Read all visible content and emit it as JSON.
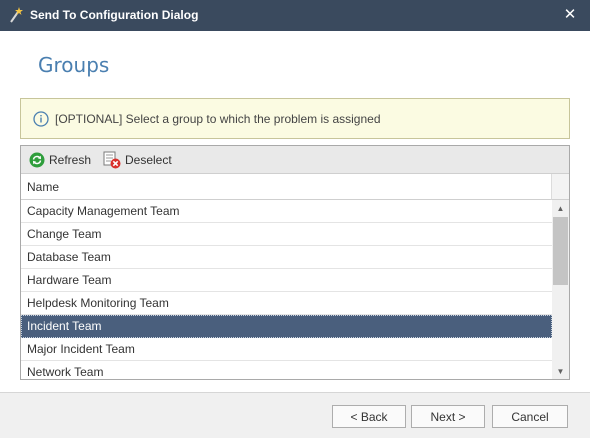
{
  "window": {
    "title": "Send To Configuration Dialog",
    "close_glyph": "✕"
  },
  "page": {
    "title": "Groups"
  },
  "info": {
    "text": "[OPTIONAL] Select a group to which the problem is assigned"
  },
  "toolbar": {
    "refresh_label": "Refresh",
    "deselect_label": "Deselect"
  },
  "grid": {
    "column_header": "Name",
    "rows": [
      {
        "name": "Capacity Management Team",
        "selected": false
      },
      {
        "name": "Change Team",
        "selected": false
      },
      {
        "name": "Database Team",
        "selected": false
      },
      {
        "name": "Hardware Team",
        "selected": false
      },
      {
        "name": "Helpdesk Monitoring Team",
        "selected": false
      },
      {
        "name": "Incident Team",
        "selected": true
      },
      {
        "name": "Major Incident Team",
        "selected": false
      },
      {
        "name": "Network Team",
        "selected": false
      }
    ]
  },
  "footer": {
    "back_label": "< Back",
    "next_label": "Next >",
    "cancel_label": "Cancel"
  },
  "colors": {
    "titlebar": "#3a4a5e",
    "accent": "#4a7fb0",
    "selected_row": "#4a5f7d",
    "info_bg": "#fbfbe2"
  },
  "icons": {
    "titlebar": "wand-icon",
    "info": "info-icon",
    "refresh": "refresh-icon",
    "deselect": "deselect-icon"
  }
}
